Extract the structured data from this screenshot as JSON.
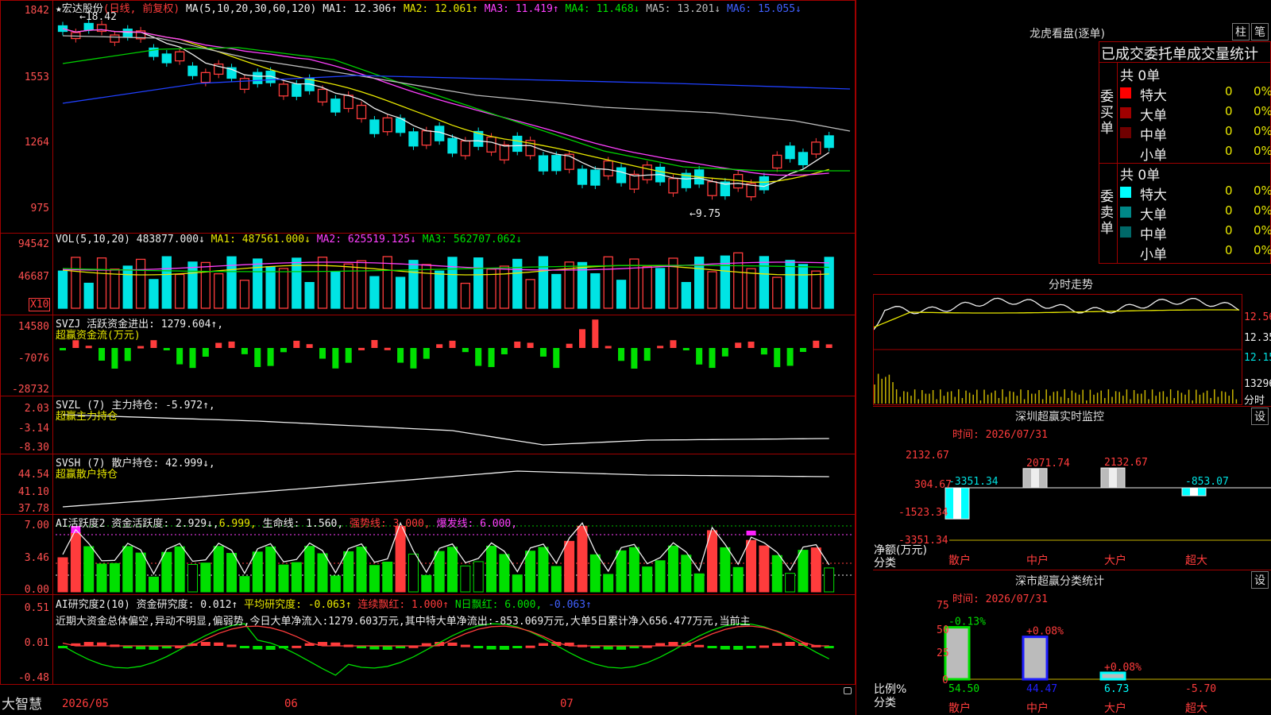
{
  "colors": {
    "up": "#ff3c3c",
    "down": "#00e4e4",
    "ma1": "#eeeeee",
    "ma2": "#e8e800",
    "ma3": "#ff40ff",
    "ma4": "#00d000",
    "ma5": "#bbbbbb",
    "ma6": "#2040ff",
    "grid": "#a00000"
  },
  "header": {
    "star": "★",
    "stock_name": "宏达股份",
    "mode": "(日线, 前复权)",
    "ma_def": "MA(5,10,20,30,60,120)",
    "ma1": "MA1: 12.306↑",
    "ma2": "MA2: 12.061↑",
    "ma3": "MA3: 11.419↑",
    "ma4": "MA4: 11.468↓",
    "ma5": "MA5: 13.201↓",
    "ma6": "MA6: 15.055↓"
  },
  "price_axis": [
    "1842",
    "1553",
    "1264",
    "975"
  ],
  "price_high_label": "18.42",
  "price_low_label": "←9.75",
  "vol": {
    "title": "VOL(5,10,20)",
    "value": "483877.000↓",
    "ma1": "MA1: 487561.000↓",
    "ma2": "MA2: 625519.125↓",
    "ma3": "MA3: 562707.062↓",
    "axis": [
      "94542",
      "46687"
    ],
    "unit": "X10"
  },
  "svzj": {
    "title": "SVZJ",
    "label": "活跃资金进出: 1279.604↑,",
    "sub": "超赢资金流(万元)",
    "axis": [
      "14580",
      "-7076",
      "-28732"
    ]
  },
  "svzl": {
    "title": "SVZL (7)",
    "label": "主力持仓: -5.972↑,",
    "sub": "超赢主力持仓",
    "axis": [
      "2.03",
      "-3.14",
      "-8.30"
    ]
  },
  "svsh": {
    "title": "SVSH (7)",
    "label": "散户持仓: 42.999↓,",
    "sub": "超赢散户持仓",
    "axis": [
      "44.54",
      "41.10",
      "37.78"
    ]
  },
  "ai_active": {
    "title": "AI活跃度2",
    "label1": "资金活跃度: 2.929↓,",
    "v2": "6.999,",
    "label3": "生命线: 1.560,",
    "label4": "强势线: 3.000,",
    "label5": "爆发线: 6.000,",
    "axis": [
      "7.00",
      "3.46",
      "0.00"
    ]
  },
  "ai_research": {
    "title": "AI研究度2(10)",
    "label1": "资金研究度: 0.012↑",
    "label2": "平均研究度: -0.063↑",
    "label3": "连续飘红: 1.000↑",
    "label4": "N日飘红: 6.000,",
    "label5": "-0.063↑",
    "text": "近期大资金总体偏空,异动不明显,偏弱势,今日大单净流入:1279.603万元,其中特大单净流出:-853.069万元,大单5日累计净入656.477万元,当前主",
    "axis": [
      "0.51",
      "0.01",
      "-0.48"
    ]
  },
  "bottom": {
    "logo": "大智慧",
    "dates": [
      "2026/05",
      "06",
      "07"
    ]
  },
  "right": {
    "lhb_title": "龙虎看盘(逐单)",
    "btn_zhu": "柱",
    "btn_bi": "笔",
    "order_title": "已成交委托单成交量统计",
    "buy": {
      "side": "委买单",
      "total": "共 0单",
      "rows": [
        {
          "name": "特大",
          "n": "0",
          "p": "0%",
          "c": "#ff0000"
        },
        {
          "name": "大单",
          "n": "0",
          "p": "0%",
          "c": "#a00000"
        },
        {
          "name": "中单",
          "n": "0",
          "p": "0%",
          "c": "#700000"
        },
        {
          "name": "小单",
          "n": "0",
          "p": "0%",
          "c": "#000000"
        }
      ]
    },
    "sell": {
      "side": "委卖单",
      "total": "共 0单",
      "rows": [
        {
          "name": "特大",
          "n": "0",
          "p": "0%",
          "c": "#00ffff"
        },
        {
          "name": "大单",
          "n": "0",
          "p": "0%",
          "c": "#008888"
        },
        {
          "name": "中单",
          "n": "0",
          "p": "0%",
          "c": "#006868"
        },
        {
          "name": "小单",
          "n": "0",
          "p": "0%",
          "c": "#000000"
        }
      ]
    },
    "fenshi": {
      "title": "分时走势",
      "axis": [
        "12.56",
        "12.35",
        "12.15"
      ],
      "vol": "13296",
      "btn": "分时"
    },
    "monitor": {
      "title": "深圳超赢实时监控",
      "btn": "设",
      "time": "时间: 2026/07/31",
      "axis": [
        "2132.67",
        "304.67",
        "-1523.34",
        "-3351.34"
      ],
      "ylabel": "净额(万元)",
      "xlabel": "分类",
      "categories": [
        "散户",
        "中户",
        "大户",
        "超大"
      ],
      "values": [
        "-3351.34",
        "2071.74",
        "2132.67",
        "-853.07"
      ]
    },
    "stats": {
      "title": "深市超赢分类统计",
      "btn": "设",
      "time": "时间: 2026/07/31",
      "axis": [
        "75",
        "50",
        "25",
        "0"
      ],
      "ylabel": "比例%",
      "xlabel": "分类",
      "categories": [
        "散户",
        "中户",
        "大户",
        "超大"
      ],
      "pct_labels": [
        "-0.13%",
        "+0.08%",
        "+0.08%",
        ""
      ],
      "values": [
        "54.50",
        "44.47",
        "6.73",
        "-5.70"
      ]
    }
  }
}
